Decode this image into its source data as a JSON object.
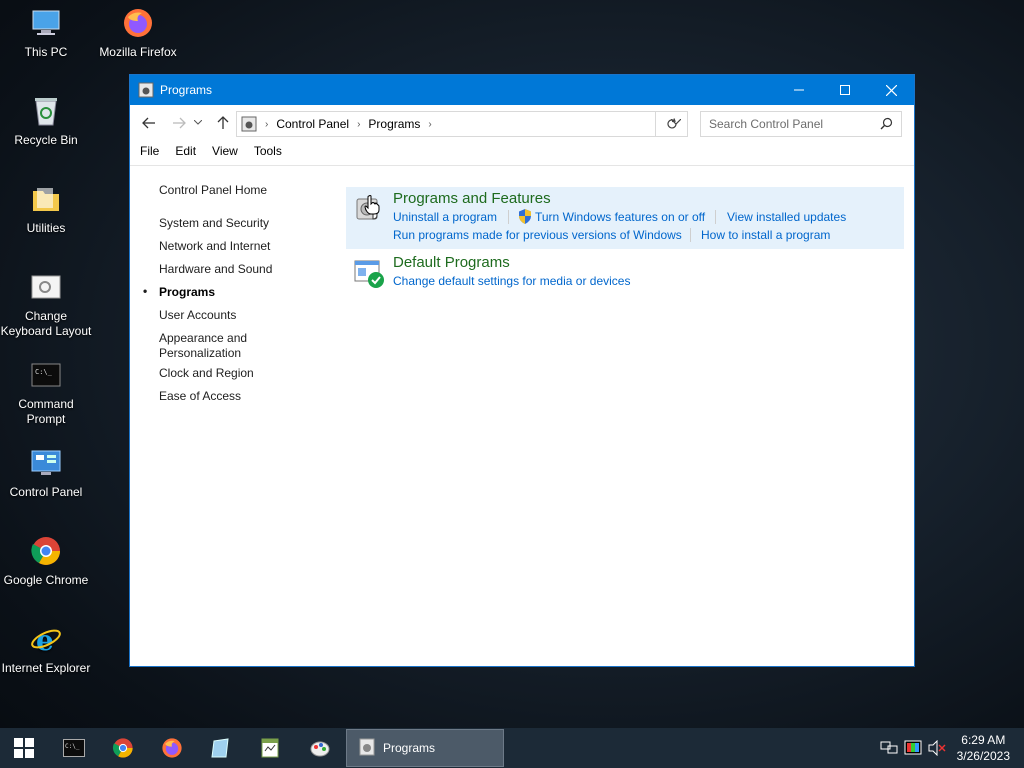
{
  "desktop": {
    "icons": [
      {
        "label": "This PC"
      },
      {
        "label": "Mozilla Firefox"
      },
      {
        "label": "Recycle Bin"
      },
      {
        "label": "Utilities"
      },
      {
        "label": "Change Keyboard Layout"
      },
      {
        "label": "Command Prompt"
      },
      {
        "label": "Control Panel"
      },
      {
        "label": "Google Chrome"
      },
      {
        "label": "Internet Explorer"
      }
    ]
  },
  "window": {
    "title": "Programs",
    "address": {
      "crumbs": [
        "Control Panel",
        "Programs"
      ]
    },
    "search_placeholder": "Search Control Panel",
    "menu": [
      "File",
      "Edit",
      "View",
      "Tools"
    ],
    "left_nav": {
      "home": "Control Panel Home",
      "items": [
        "System and Security",
        "Network and Internet",
        "Hardware and Sound",
        "Programs",
        "User Accounts",
        "Appearance and Personalization",
        "Clock and Region",
        "Ease of Access"
      ],
      "active": "Programs"
    },
    "categories": [
      {
        "title": "Programs and Features",
        "links": [
          "Uninstall a program",
          "Turn Windows features on or off",
          "View installed updates",
          "Run programs made for previous versions of Windows",
          "How to install a program"
        ]
      },
      {
        "title": "Default Programs",
        "links": [
          "Change default settings for media or devices"
        ]
      }
    ]
  },
  "taskbar": {
    "active_window": "Programs",
    "time": "6:29 AM",
    "date": "3/26/2023"
  },
  "colors": {
    "titlebar": "#0078d7",
    "link": "#0066cc",
    "category_title": "#1e6b1e",
    "hover_bg": "#e5f1fb"
  }
}
